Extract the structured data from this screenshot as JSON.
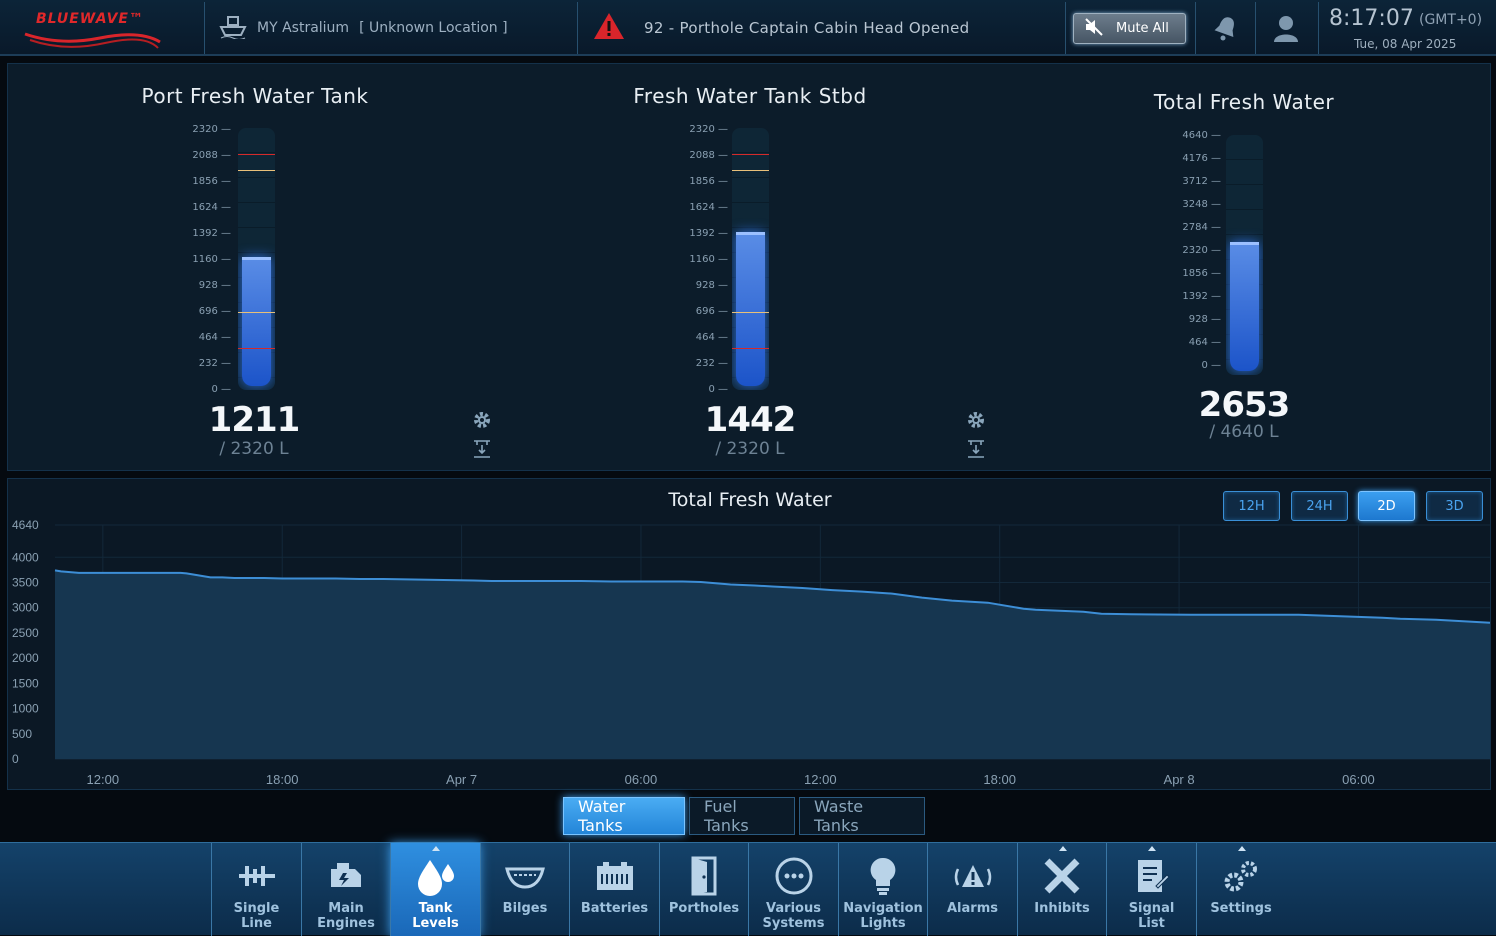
{
  "header": {
    "logo_text": "BLUEWAVE™",
    "vessel_name": "MY Astralium",
    "location": "[ Unknown Location ]",
    "alarm_text": "92 - Porthole Captain Cabin Head Opened",
    "mute_label": "Mute All",
    "time": "8:17:07",
    "timezone": "(GMT+0)",
    "date": "Tue, 08 Apr 2025"
  },
  "tanks": [
    {
      "title": "Port Fresh Water Tank",
      "value": "1211",
      "capacity": "/ 2320 L",
      "level": 1211,
      "max": 2320,
      "scale": [
        "2320",
        "2088",
        "1856",
        "1624",
        "1392",
        "1160",
        "928",
        "696",
        "464",
        "232",
        "0"
      ]
    },
    {
      "title": "Fresh Water Tank Stbd",
      "value": "1442",
      "capacity": "/ 2320 L",
      "level": 1442,
      "max": 2320,
      "scale": [
        "2320",
        "2088",
        "1856",
        "1624",
        "1392",
        "1160",
        "928",
        "696",
        "464",
        "232",
        "0"
      ]
    },
    {
      "title": "Total Fresh Water",
      "value": "2653",
      "capacity": "/ 4640 L",
      "level": 2653,
      "max": 4640,
      "scale": [
        "4640",
        "4176",
        "3712",
        "3248",
        "2784",
        "2320",
        "1856",
        "1392",
        "928",
        "464",
        "0"
      ]
    }
  ],
  "chart": {
    "title": "Total Fresh Water",
    "ranges": [
      "12H",
      "24H",
      "2D",
      "3D"
    ],
    "selected_range": "2D"
  },
  "chart_data": {
    "type": "area",
    "title": "Total Fresh Water",
    "ylim": [
      0,
      4640
    ],
    "y_ticks": [
      "4640",
      "4000",
      "3500",
      "3000",
      "2500",
      "2000",
      "1500",
      "1000",
      "500",
      "0"
    ],
    "x_ticks": [
      "12:00",
      "18:00",
      "Apr 7",
      "06:00",
      "12:00",
      "18:00",
      "Apr 8",
      "06:00"
    ],
    "x_hours": [
      0,
      1,
      3,
      4,
      6,
      10,
      12,
      16,
      21,
      22,
      25,
      26,
      28,
      30,
      32,
      35,
      38,
      42,
      44,
      47,
      51,
      55,
      60,
      65,
      70,
      73,
      77,
      79,
      82,
      88,
      93,
      98,
      105,
      108,
      113,
      117,
      120,
      125,
      130,
      135,
      140,
      145,
      150,
      156,
      162,
      164,
      172,
      175,
      180,
      190,
      200,
      208,
      222,
      225,
      231,
      240
    ],
    "x_tick_hours": [
      8,
      38,
      68,
      98,
      128,
      158,
      188,
      218
    ],
    "y": [
      3740,
      3720,
      3700,
      3690,
      3690,
      3690,
      3690,
      3690,
      3690,
      3680,
      3620,
      3600,
      3600,
      3590,
      3590,
      3590,
      3580,
      3580,
      3580,
      3580,
      3570,
      3570,
      3560,
      3550,
      3540,
      3530,
      3530,
      3530,
      3530,
      3530,
      3520,
      3520,
      3520,
      3510,
      3460,
      3440,
      3420,
      3390,
      3350,
      3320,
      3280,
      3200,
      3140,
      3100,
      2980,
      2960,
      2920,
      2880,
      2870,
      2860,
      2860,
      2860,
      2800,
      2780,
      2760,
      2700
    ]
  },
  "bottom_tabs": [
    "Water Tanks",
    "Fuel Tanks",
    "Waste Tanks"
  ],
  "active_tab": "Water Tanks",
  "nav": [
    {
      "name": "single-line",
      "label1": "Single",
      "label2": "Line",
      "icon": "single-line-icon"
    },
    {
      "name": "main-engines",
      "label1": "Main",
      "label2": "Engines",
      "icon": "engine-icon"
    },
    {
      "name": "tank-levels",
      "label1": "Tank",
      "label2": "Levels",
      "icon": "water-drops-icon"
    },
    {
      "name": "bilges",
      "label1": "Bilges",
      "label2": "",
      "icon": "bilge-icon"
    },
    {
      "name": "batteries",
      "label1": "Batteries",
      "label2": "",
      "icon": "battery-icon"
    },
    {
      "name": "portholes",
      "label1": "Portholes",
      "label2": "",
      "icon": "door-icon"
    },
    {
      "name": "various-systems",
      "label1": "Various",
      "label2": "Systems",
      "icon": "dots-icon"
    },
    {
      "name": "navigation-lights",
      "label1": "Navigation",
      "label2": "Lights",
      "icon": "bulb-icon"
    },
    {
      "name": "alarms",
      "label1": "Alarms",
      "label2": "",
      "icon": "alarm-icon"
    },
    {
      "name": "inhibits",
      "label1": "Inhibits",
      "label2": "",
      "icon": "cross-icon"
    },
    {
      "name": "signal-list",
      "label1": "Signal",
      "label2": "List",
      "icon": "signal-list-icon"
    },
    {
      "name": "settings",
      "label1": "Settings",
      "label2": "",
      "icon": "gears-icon"
    }
  ],
  "colors": {
    "accent": "#3a9ae8",
    "fill": "#1c54c9",
    "alarm_red": "#d9252b",
    "high_line": "#d42a2a",
    "warn_line": "#e8c07a"
  }
}
